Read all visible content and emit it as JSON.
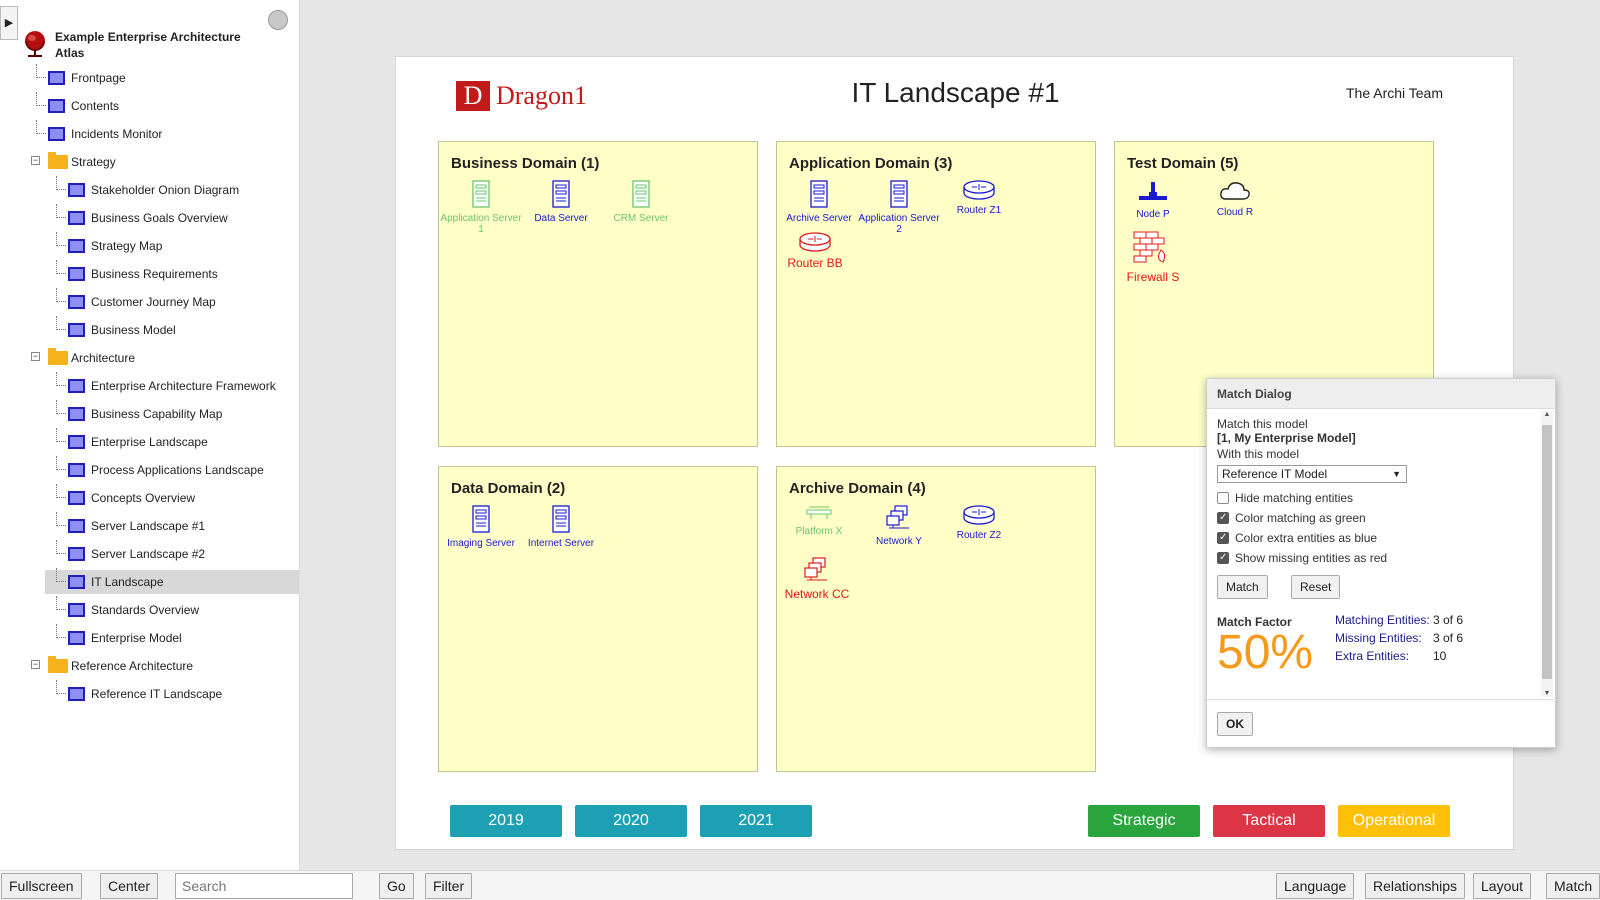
{
  "sidebar": {
    "toggle_glyph": "▶",
    "root_title": "Example Enterprise Architecture Atlas",
    "items": [
      {
        "label": "Frontpage",
        "kind": "page"
      },
      {
        "label": "Contents",
        "kind": "page"
      },
      {
        "label": "Incidents Monitor",
        "kind": "page"
      },
      {
        "label": "Strategy",
        "kind": "folder"
      },
      {
        "label": "Stakeholder Onion Diagram",
        "kind": "page"
      },
      {
        "label": "Business Goals Overview",
        "kind": "page"
      },
      {
        "label": "Strategy Map",
        "kind": "page"
      },
      {
        "label": "Business Requirements",
        "kind": "page"
      },
      {
        "label": "Customer Journey Map",
        "kind": "page"
      },
      {
        "label": "Business Model",
        "kind": "page"
      },
      {
        "label": "Architecture",
        "kind": "folder"
      },
      {
        "label": "Enterprise Architecture Framework",
        "kind": "page"
      },
      {
        "label": "Business Capability Map",
        "kind": "page"
      },
      {
        "label": "Enterprise Landscape",
        "kind": "page"
      },
      {
        "label": "Process Applications Landscape",
        "kind": "page"
      },
      {
        "label": "Concepts Overview",
        "kind": "page"
      },
      {
        "label": "Server Landscape #1",
        "kind": "page"
      },
      {
        "label": "Server Landscape #2",
        "kind": "page"
      },
      {
        "label": "IT Landscape",
        "kind": "page",
        "selected": true
      },
      {
        "label": "Standards Overview",
        "kind": "page"
      },
      {
        "label": "Enterprise Model",
        "kind": "page"
      },
      {
        "label": "Reference Architecture",
        "kind": "folder"
      },
      {
        "label": "Reference IT Landscape",
        "kind": "page"
      }
    ]
  },
  "canvas": {
    "logo_letter": "D",
    "logo_text": "Dragon1",
    "title": "IT Landscape #1",
    "author": "The Archi Team",
    "domains": [
      {
        "title": "Business Domain (1)",
        "entities": [
          {
            "label": "Application Server 1",
            "icon": "server-icon",
            "color": "green"
          },
          {
            "label": "Data Server",
            "icon": "server-icon",
            "color": "blue"
          },
          {
            "label": "CRM Server",
            "icon": "server-icon",
            "color": "green"
          }
        ]
      },
      {
        "title": "Application Domain (3)",
        "entities": [
          {
            "label": "Archive Server",
            "icon": "server-icon",
            "color": "blue"
          },
          {
            "label": "Application Server 2",
            "icon": "server-icon",
            "color": "blue"
          },
          {
            "label": "Router Z1",
            "icon": "router-icon",
            "color": "blue"
          },
          {
            "label": "Router BB",
            "icon": "router-icon",
            "color": "red"
          }
        ]
      },
      {
        "title": "Test Domain (5)",
        "entities": [
          {
            "label": "Node P",
            "icon": "node-icon",
            "color": "blue"
          },
          {
            "label": "Cloud R",
            "icon": "cloud-icon",
            "color": "blue"
          },
          {
            "label": "Firewall S",
            "icon": "firewall-icon",
            "color": "red"
          }
        ]
      },
      {
        "title": "Data Domain (2)",
        "entities": [
          {
            "label": "Imaging Server",
            "icon": "server-icon",
            "color": "blue"
          },
          {
            "label": "Internet Server",
            "icon": "server-icon",
            "color": "blue"
          }
        ]
      },
      {
        "title": "Archive Domain (4)",
        "entities": [
          {
            "label": "Platform X",
            "icon": "platform-icon",
            "color": "green"
          },
          {
            "label": "Network Y",
            "icon": "network-icon",
            "color": "blue"
          },
          {
            "label": "Router Z2",
            "icon": "router-icon",
            "color": "blue"
          },
          {
            "label": "Network CC",
            "icon": "network-icon",
            "color": "red"
          }
        ]
      }
    ],
    "year_buttons": [
      "2019",
      "2020",
      "2021"
    ],
    "category_buttons": [
      {
        "label": "Strategic",
        "color": "#2aa53e"
      },
      {
        "label": "Tactical",
        "color": "#dc3545"
      },
      {
        "label": "Operational",
        "color": "#ffc107"
      }
    ]
  },
  "match_dialog": {
    "title": "Match Dialog",
    "match_this_model": "Match this model",
    "model_name": "[1, My Enterprise Model]",
    "with_this_model": "With this model",
    "selected_model": "Reference IT Model",
    "options": [
      {
        "label": "Hide matching entities",
        "checked": false
      },
      {
        "label": "Color matching as green",
        "checked": true
      },
      {
        "label": "Color extra entities as blue",
        "checked": true
      },
      {
        "label": "Show missing entities as red",
        "checked": true
      }
    ],
    "match_button": "Match",
    "reset_button": "Reset",
    "match_factor_label": "Match Factor",
    "match_factor_value": "50%",
    "stats": [
      {
        "key": "Matching Entities:",
        "value": "3 of 6"
      },
      {
        "key": "Missing Entities:",
        "value": "3 of 6"
      },
      {
        "key": "Extra Entities:",
        "value": "10"
      }
    ],
    "ok_button": "OK"
  },
  "toolbar": {
    "fullscreen": "Fullscreen",
    "center": "Center",
    "search_placeholder": "Search",
    "go": "Go",
    "filter": "Filter",
    "language": "Language",
    "relationships": "Relationships",
    "layout": "Layout",
    "match": "Match"
  },
  "colors": {
    "green": "#6cc46c",
    "blue": "#1a1ad0",
    "red": "#e01a1a",
    "domain_fill": "#ffffc8",
    "match_factor": "#f59a1a"
  }
}
